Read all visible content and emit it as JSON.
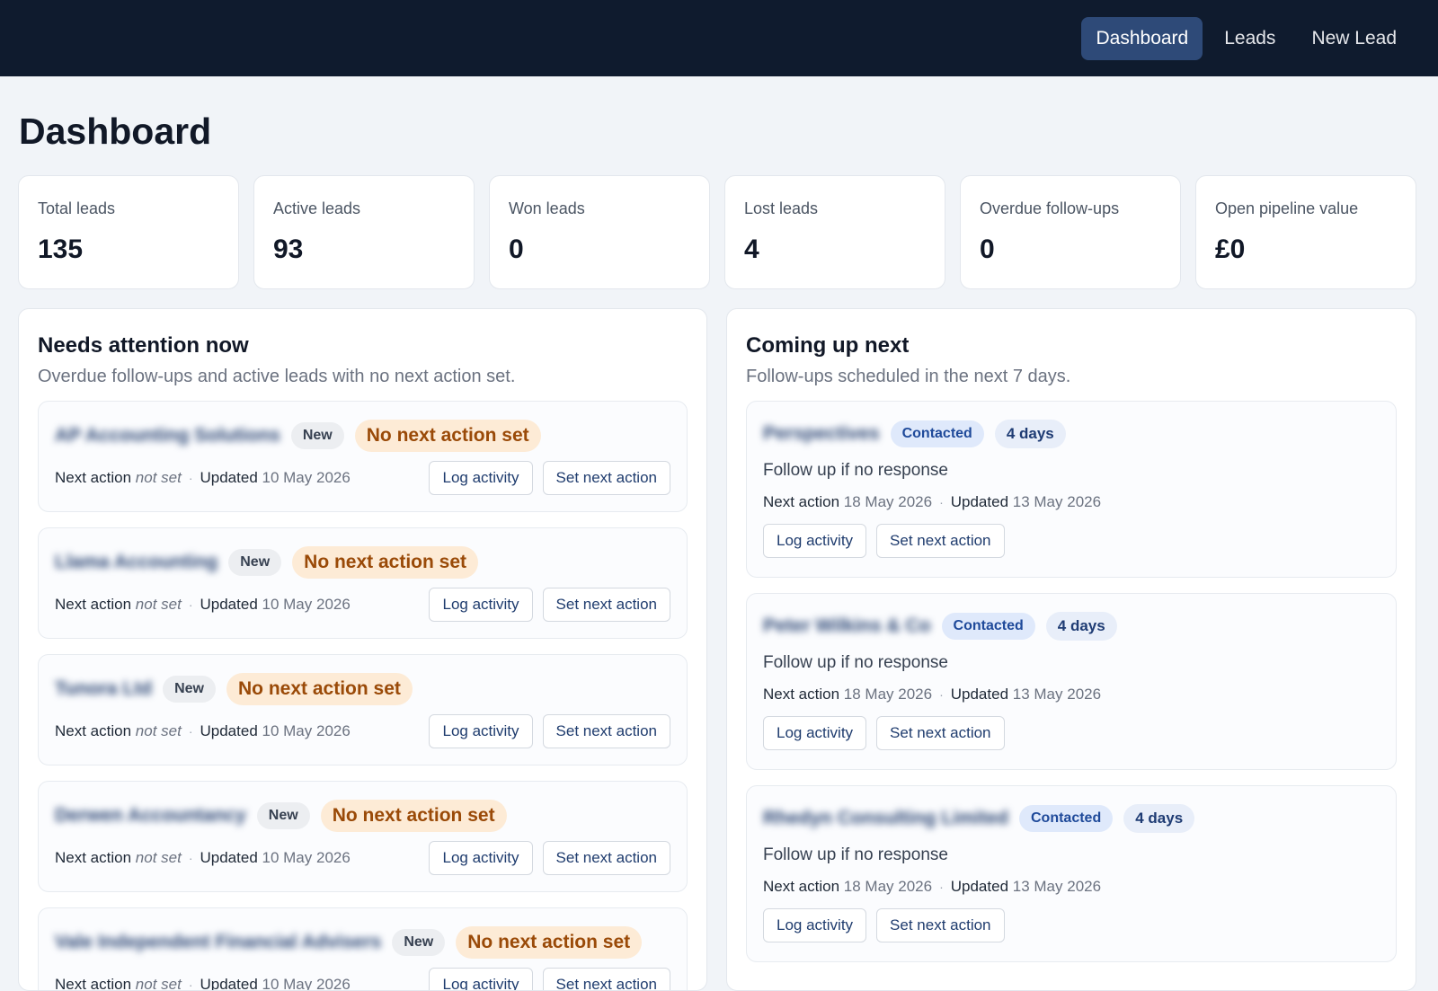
{
  "nav": {
    "dashboard": "Dashboard",
    "leads": "Leads",
    "new_lead": "New Lead"
  },
  "page": {
    "title": "Dashboard"
  },
  "stats": [
    {
      "label": "Total leads",
      "value": "135"
    },
    {
      "label": "Active leads",
      "value": "93"
    },
    {
      "label": "Won leads",
      "value": "0"
    },
    {
      "label": "Lost leads",
      "value": "4"
    },
    {
      "label": "Overdue follow-ups",
      "value": "0"
    },
    {
      "label": "Open pipeline value",
      "value": "£0"
    }
  ],
  "attention": {
    "title": "Needs attention now",
    "subtitle": "Overdue follow-ups and active leads with no next action set.",
    "items": [
      {
        "name": "AP Accounting Solutions",
        "status": "New",
        "flag": "No next action set",
        "next_label": "Next action",
        "next_value": "not set",
        "updated_label": "Updated",
        "updated_value": "10 May 2026",
        "log": "Log activity",
        "set": "Set next action"
      },
      {
        "name": "Llama Accounting",
        "status": "New",
        "flag": "No next action set",
        "next_label": "Next action",
        "next_value": "not set",
        "updated_label": "Updated",
        "updated_value": "10 May 2026",
        "log": "Log activity",
        "set": "Set next action"
      },
      {
        "name": "Tunora Ltd",
        "status": "New",
        "flag": "No next action set",
        "next_label": "Next action",
        "next_value": "not set",
        "updated_label": "Updated",
        "updated_value": "10 May 2026",
        "log": "Log activity",
        "set": "Set next action"
      },
      {
        "name": "Derwen Accountancy",
        "status": "New",
        "flag": "No next action set",
        "next_label": "Next action",
        "next_value": "not set",
        "updated_label": "Updated",
        "updated_value": "10 May 2026",
        "log": "Log activity",
        "set": "Set next action"
      },
      {
        "name": "Vale Independent Financial Advisers",
        "status": "New",
        "flag": "No next action set",
        "next_label": "Next action",
        "next_value": "not set",
        "updated_label": "Updated",
        "updated_value": "10 May 2026",
        "log": "Log activity",
        "set": "Set next action"
      }
    ]
  },
  "upcoming": {
    "title": "Coming up next",
    "subtitle": "Follow-ups scheduled in the next 7 days.",
    "items": [
      {
        "name": "Perspectives",
        "status": "Contacted",
        "days": "4 days",
        "note": "Follow up if no response",
        "next_label": "Next action",
        "next_value": "18 May 2026",
        "updated_label": "Updated",
        "updated_value": "13 May 2026",
        "log": "Log activity",
        "set": "Set next action"
      },
      {
        "name": "Peter Wilkins & Co",
        "status": "Contacted",
        "days": "4 days",
        "note": "Follow up if no response",
        "next_label": "Next action",
        "next_value": "18 May 2026",
        "updated_label": "Updated",
        "updated_value": "13 May 2026",
        "log": "Log activity",
        "set": "Set next action"
      },
      {
        "name": "Rhedyn Consulting Limited",
        "status": "Contacted",
        "days": "4 days",
        "note": "Follow up if no response",
        "next_label": "Next action",
        "next_value": "18 May 2026",
        "updated_label": "Updated",
        "updated_value": "13 May 2026",
        "log": "Log activity",
        "set": "Set next action"
      }
    ]
  }
}
